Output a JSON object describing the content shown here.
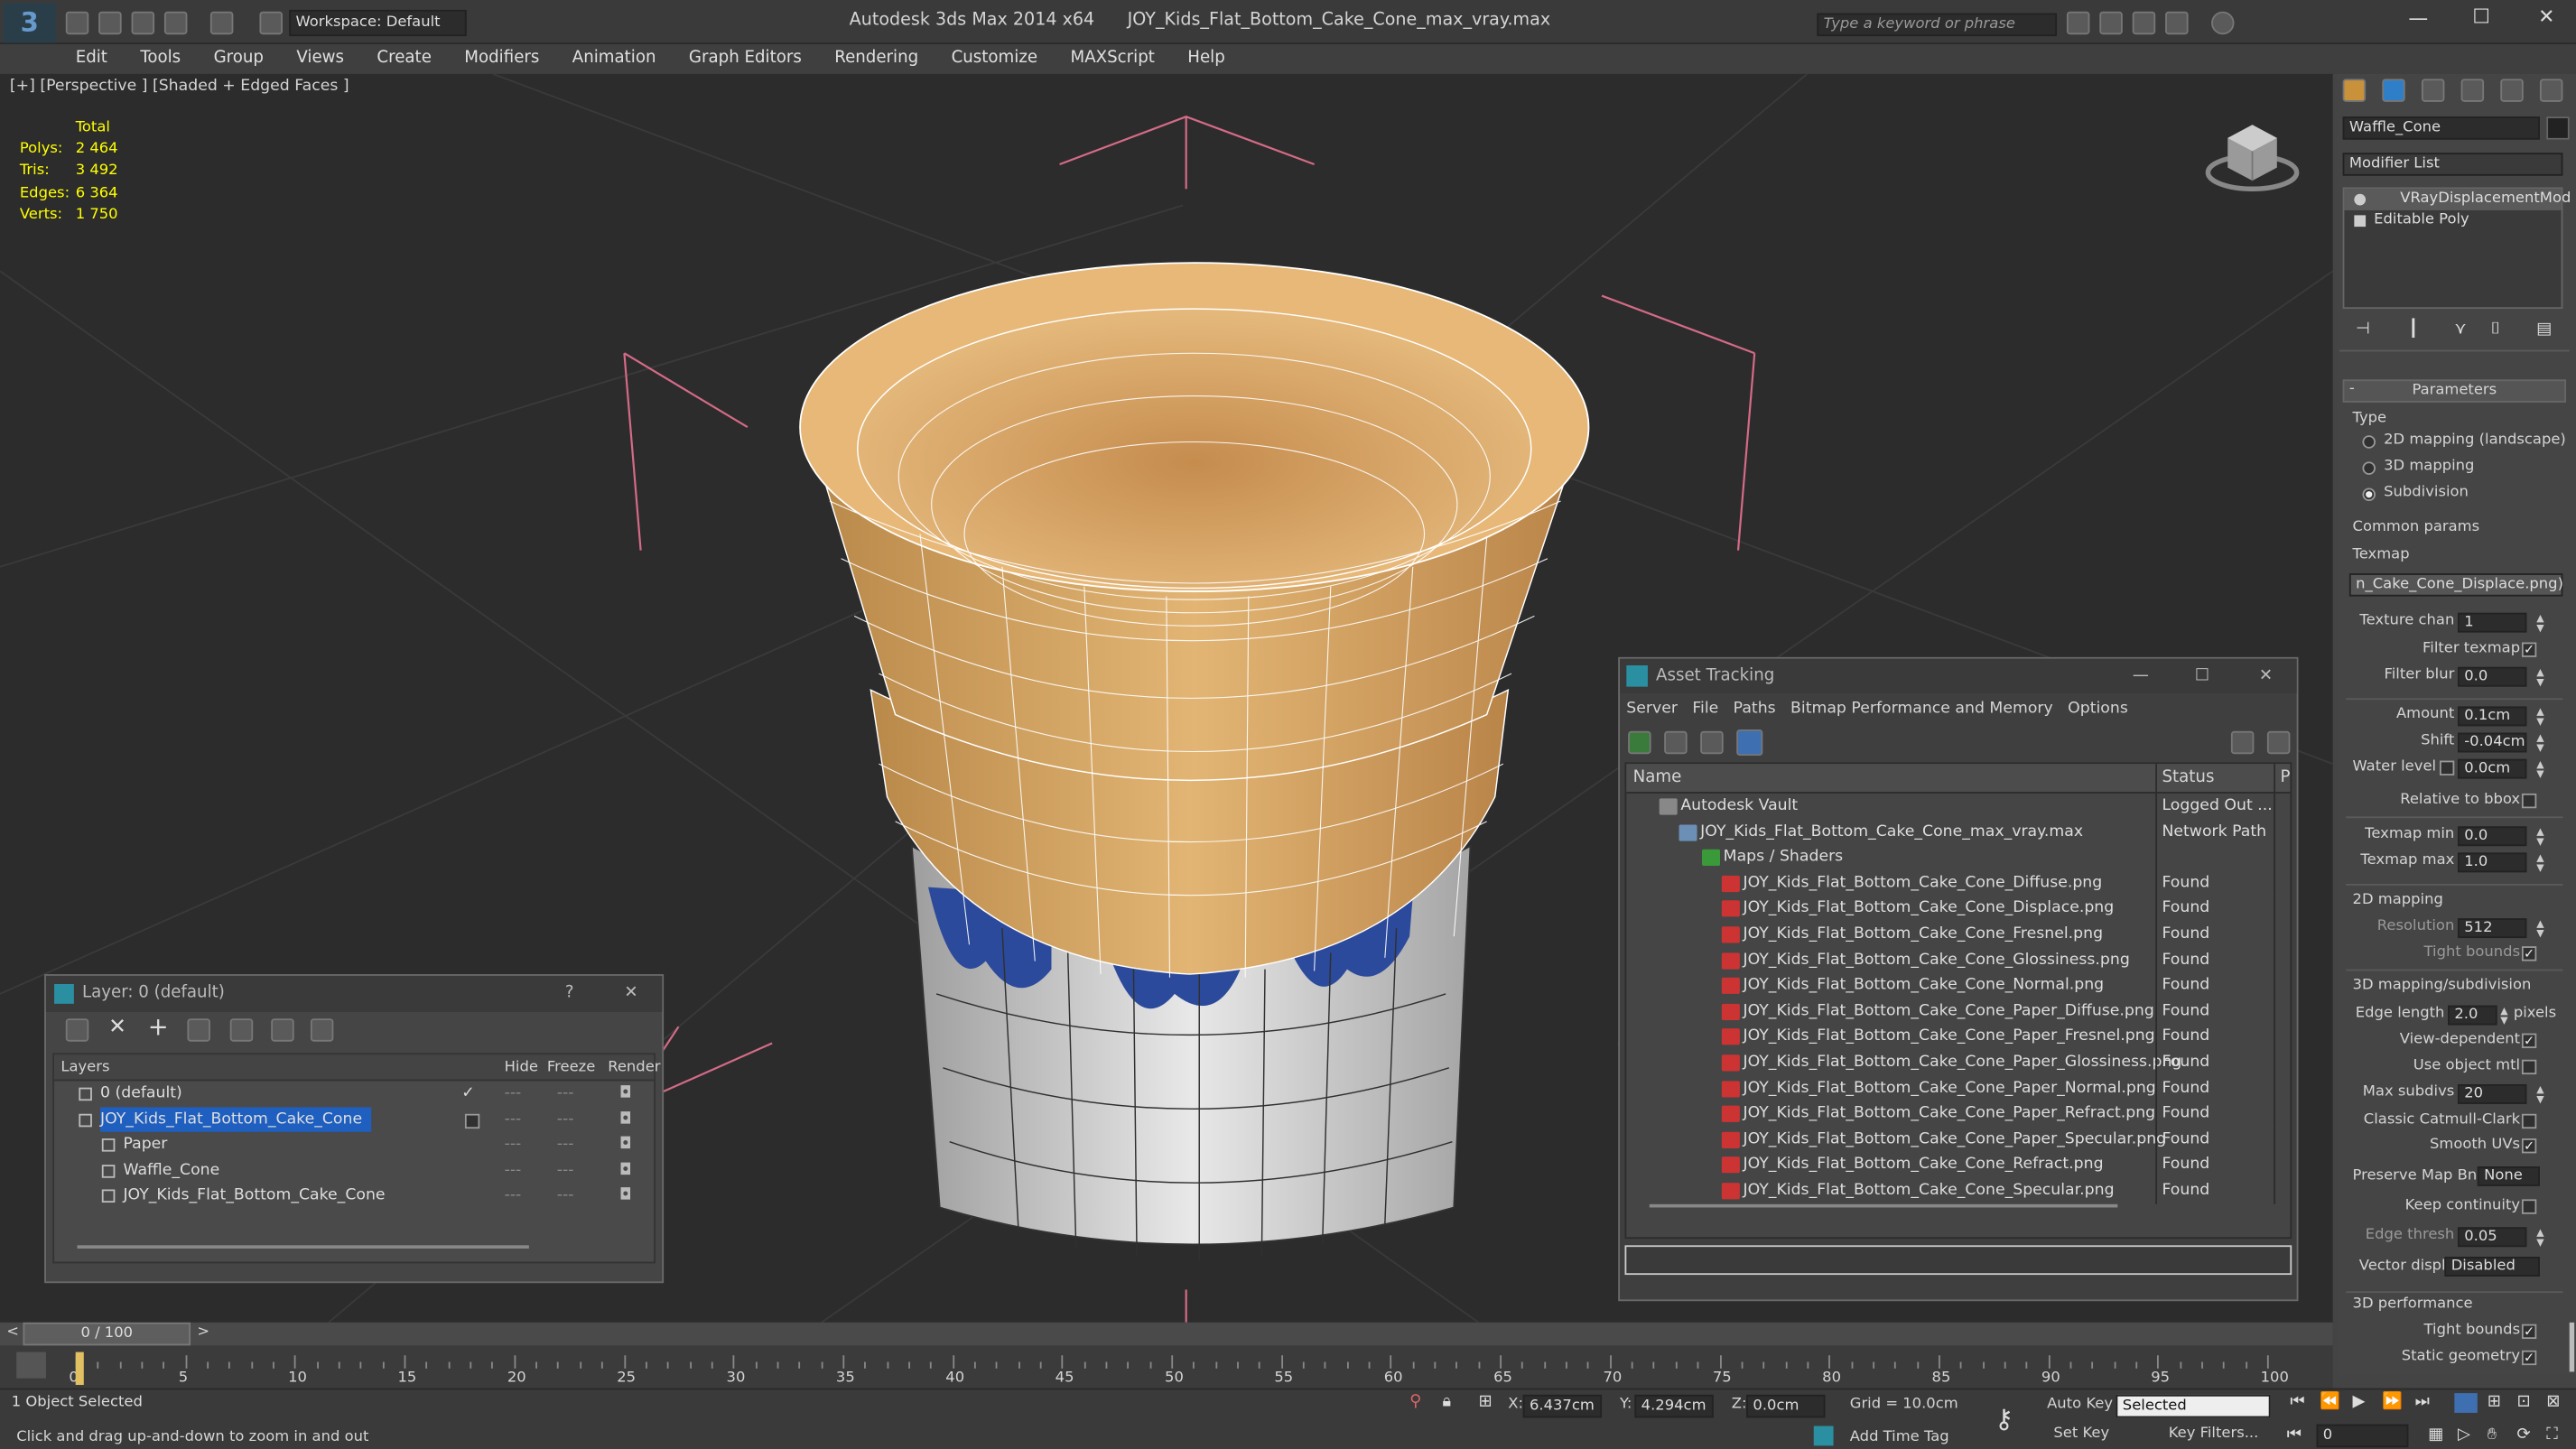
{
  "app": {
    "title": "Autodesk 3ds Max  2014 x64",
    "file": "JOY_Kids_Flat_Bottom_Cake_Cone_max_vray.max",
    "workspace": "Workspace: Default",
    "search_placeholder": "Type a keyword or phrase"
  },
  "menu": [
    "Edit",
    "Tools",
    "Group",
    "Views",
    "Create",
    "Modifiers",
    "Animation",
    "Graph Editors",
    "Rendering",
    "Customize",
    "MAXScript",
    "Help"
  ],
  "viewport": {
    "label": "[+] [Perspective ] [Shaded + Edged Faces ]",
    "stats": {
      "total": "Total",
      "rows": [
        {
          "k": "Polys:",
          "v": "2 464"
        },
        {
          "k": "Tris:",
          "v": "3 492"
        },
        {
          "k": "Edges:",
          "v": "6 364"
        },
        {
          "k": "Verts:",
          "v": "1 750"
        }
      ]
    }
  },
  "layer_dialog": {
    "title": "Layer: 0 (default)",
    "help": "?",
    "close": "✕",
    "columns": [
      "Layers",
      "Hide",
      "Freeze",
      "Render"
    ],
    "rows": [
      {
        "name": "0 (default)",
        "indent": 1
      },
      {
        "name": "JOY_Kids_Flat_Bottom_Cake_Cone",
        "indent": 1,
        "selected": true
      },
      {
        "name": "Paper",
        "indent": 2
      },
      {
        "name": "Waffle_Cone",
        "indent": 2
      },
      {
        "name": "JOY_Kids_Flat_Bottom_Cake_Cone",
        "indent": 2
      }
    ]
  },
  "asset_tracking": {
    "title": "Asset Tracking",
    "menu": [
      "Server",
      "File",
      "Paths",
      "Bitmap Performance and Memory",
      "Options"
    ],
    "columns": {
      "name": "Name",
      "status": "Status",
      "p": "P"
    },
    "rows": [
      {
        "name": "Autodesk Vault",
        "status": "Logged Out ...",
        "indent": 1,
        "icon": "vault"
      },
      {
        "name": "JOY_Kids_Flat_Bottom_Cake_Cone_max_vray.max",
        "status": "Network Path",
        "indent": 2,
        "icon": "max"
      },
      {
        "name": "Maps / Shaders",
        "status": "",
        "indent": 3,
        "icon": "maps"
      },
      {
        "name": "JOY_Kids_Flat_Bottom_Cake_Cone_Diffuse.png",
        "status": "Found",
        "indent": 4,
        "icon": "png"
      },
      {
        "name": "JOY_Kids_Flat_Bottom_Cake_Cone_Displace.png",
        "status": "Found",
        "indent": 4,
        "icon": "png"
      },
      {
        "name": "JOY_Kids_Flat_Bottom_Cake_Cone_Fresnel.png",
        "status": "Found",
        "indent": 4,
        "icon": "png"
      },
      {
        "name": "JOY_Kids_Flat_Bottom_Cake_Cone_Glossiness.png",
        "status": "Found",
        "indent": 4,
        "icon": "png"
      },
      {
        "name": "JOY_Kids_Flat_Bottom_Cake_Cone_Normal.png",
        "status": "Found",
        "indent": 4,
        "icon": "png"
      },
      {
        "name": "JOY_Kids_Flat_Bottom_Cake_Cone_Paper_Diffuse.png",
        "status": "Found",
        "indent": 4,
        "icon": "png"
      },
      {
        "name": "JOY_Kids_Flat_Bottom_Cake_Cone_Paper_Fresnel.png",
        "status": "Found",
        "indent": 4,
        "icon": "png"
      },
      {
        "name": "JOY_Kids_Flat_Bottom_Cake_Cone_Paper_Glossiness.png",
        "status": "Found",
        "indent": 4,
        "icon": "png"
      },
      {
        "name": "JOY_Kids_Flat_Bottom_Cake_Cone_Paper_Normal.png",
        "status": "Found",
        "indent": 4,
        "icon": "png"
      },
      {
        "name": "JOY_Kids_Flat_Bottom_Cake_Cone_Paper_Refract.png",
        "status": "Found",
        "indent": 4,
        "icon": "png"
      },
      {
        "name": "JOY_Kids_Flat_Bottom_Cake_Cone_Paper_Specular.png",
        "status": "Found",
        "indent": 4,
        "icon": "png"
      },
      {
        "name": "JOY_Kids_Flat_Bottom_Cake_Cone_Refract.png",
        "status": "Found",
        "indent": 4,
        "icon": "png"
      },
      {
        "name": "JOY_Kids_Flat_Bottom_Cake_Cone_Specular.png",
        "status": "Found",
        "indent": 4,
        "icon": "png"
      }
    ]
  },
  "command_panel": {
    "object_name": "Waffle_Cone",
    "modifier_list": "Modifier List",
    "stack": [
      "VRayDisplacementMod",
      "Editable Poly"
    ],
    "rollout": "Parameters",
    "type_label": "Type",
    "types": [
      "2D mapping (landscape)",
      "3D mapping",
      "Subdivision"
    ],
    "type_selected": 2,
    "common": "Common params",
    "texmap": "Texmap",
    "texmap_value": "n_Cake_Cone_Displace.png)",
    "texture_chan": {
      "label": "Texture chan",
      "value": "1"
    },
    "filter_texmap": "Filter texmap",
    "filter_blur": {
      "label": "Filter blur",
      "value": "0.0"
    },
    "amount": {
      "label": "Amount",
      "value": "0.1cm"
    },
    "shift": {
      "label": "Shift",
      "value": "-0.04cm"
    },
    "water": {
      "label": "Water level",
      "value": "0.0cm"
    },
    "relative": "Relative to bbox",
    "tmin": {
      "label": "Texmap min",
      "value": "0.0"
    },
    "tmax": {
      "label": "Texmap max",
      "value": "1.0"
    },
    "m2d": "2D mapping",
    "resolution": {
      "label": "Resolution",
      "value": "512"
    },
    "tight1": "Tight bounds",
    "m3d": "3D mapping/subdivision",
    "edge_len": {
      "label": "Edge length",
      "value": "2.0",
      "unit": "pixels"
    },
    "view_dep": "View-dependent",
    "use_obj": "Use object mtl",
    "max_sub": {
      "label": "Max subdivs",
      "value": "20"
    },
    "catmull": "Classic Catmull-Clark",
    "smooth": "Smooth UVs",
    "preserve": {
      "label": "Preserve Map Bnd",
      "value": "None"
    },
    "keep": "Keep continuity",
    "edge_thresh": {
      "label": "Edge thresh",
      "value": "0.05"
    },
    "vector": {
      "label": "Vector displ",
      "value": "Disabled"
    },
    "perf": "3D performance",
    "tight2": "Tight bounds",
    "static": "Static geometry"
  },
  "timeline": {
    "frame": "0 / 100",
    "ticks": [
      "0",
      "5",
      "10",
      "15",
      "20",
      "25",
      "30",
      "35",
      "40",
      "45",
      "50",
      "55",
      "60",
      "65",
      "70",
      "75",
      "80",
      "85",
      "90",
      "95",
      "100"
    ]
  },
  "status": {
    "selected": "1 Object Selected",
    "hint": "Click and drag up-and-down to zoom in and out",
    "x_label": "X:",
    "x": "6.437cm",
    "y_label": "Y:",
    "y": "4.294cm",
    "z_label": "Z:",
    "z": "0.0cm",
    "grid": "Grid = 10.0cm",
    "add_time_tag": "Add Time Tag",
    "auto_key": "Auto Key",
    "set_key": "Set Key",
    "selected_dd": "Selected",
    "key_filters": "Key Filters...",
    "frame_field": "0"
  }
}
